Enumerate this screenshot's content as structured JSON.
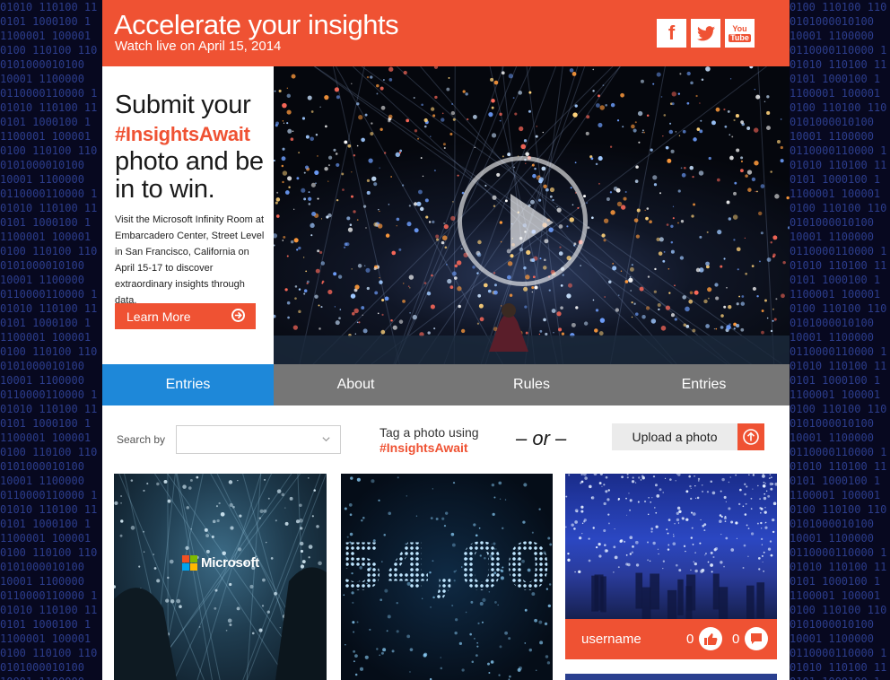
{
  "header": {
    "title": "Accelerate your insights",
    "subtitle": "Watch live on April 15, 2014",
    "social": [
      {
        "name": "facebook",
        "icon": "facebook-icon",
        "label": "f"
      },
      {
        "name": "twitter",
        "icon": "twitter-icon"
      },
      {
        "name": "youtube",
        "icon": "youtube-icon",
        "label_top": "You",
        "label_bottom": "Tube"
      }
    ]
  },
  "promo": {
    "headline_1": "Submit your",
    "hashtag": "#InsightsAwait",
    "headline_2": "photo and be in to win.",
    "description": "Visit the Microsoft Infinity Room at Embarcadero Center, Street Level in San Francisco, California on April 15-17 to discover extraordinary insights through data.",
    "learn_more_label": "Learn More"
  },
  "video": {
    "play_icon": "play-icon"
  },
  "tabs": [
    {
      "label": "Entries",
      "active": true
    },
    {
      "label": "About",
      "active": false
    },
    {
      "label": "Rules",
      "active": false
    },
    {
      "label": "Entries",
      "active": false
    }
  ],
  "toolbar": {
    "search_label": "Search by",
    "search_value": "",
    "tag_line": "Tag a photo using",
    "tag_hashtag": "#InsightsAwait",
    "or_text": "– or –",
    "upload_label": "Upload a photo"
  },
  "cards": [
    {
      "overlay_text": "Microsoft"
    },
    {
      "overlay_text": "54,00"
    },
    {
      "username": "username",
      "likes": "0",
      "comments": "0"
    }
  ],
  "background": {
    "binary_rows": [
      "01010 110100 11",
      "0101 1000100 1",
      "1100001 100001",
      "0100 110100 110",
      "0101000010100",
      "10001 1100000",
      "0110000110000 1"
    ]
  },
  "colors": {
    "accent": "#ef5233",
    "tab_active": "#1e88d9",
    "tab_bar": "#767676",
    "background": "#07081f"
  }
}
